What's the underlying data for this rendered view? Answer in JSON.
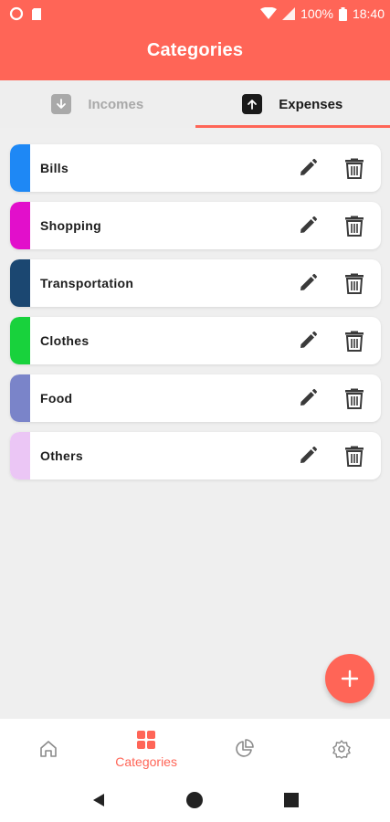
{
  "status_bar": {
    "battery_percent": "100%",
    "time": "18:40"
  },
  "header": {
    "title": "Categories"
  },
  "tabs": [
    {
      "label": "Incomes",
      "icon": "arrow-down-icon",
      "active": false
    },
    {
      "label": "Expenses",
      "icon": "arrow-up-icon",
      "active": true
    }
  ],
  "categories": [
    {
      "label": "Bills",
      "color": "#1e88f5"
    },
    {
      "label": "Shopping",
      "color": "#e20fcb"
    },
    {
      "label": "Transportation",
      "color": "#1b4771"
    },
    {
      "label": "Clothes",
      "color": "#18d23c"
    },
    {
      "label": "Food",
      "color": "#7a84c9"
    },
    {
      "label": "Others",
      "color": "#ebc6f5"
    }
  ],
  "fab": {
    "icon": "plus-icon"
  },
  "bottom_nav": {
    "items": [
      {
        "name": "home",
        "icon": "home-icon",
        "label": "",
        "active": false
      },
      {
        "name": "categories",
        "icon": "grid-icon",
        "label": "Categories",
        "active": true
      },
      {
        "name": "stats",
        "icon": "pie-chart-icon",
        "label": "",
        "active": false
      },
      {
        "name": "settings",
        "icon": "gear-icon",
        "label": "",
        "active": false
      }
    ]
  },
  "colors": {
    "accent": "#ff6557",
    "background": "#efefef",
    "text_dark": "#1d1d1d",
    "text_muted": "#a9a9a9"
  }
}
